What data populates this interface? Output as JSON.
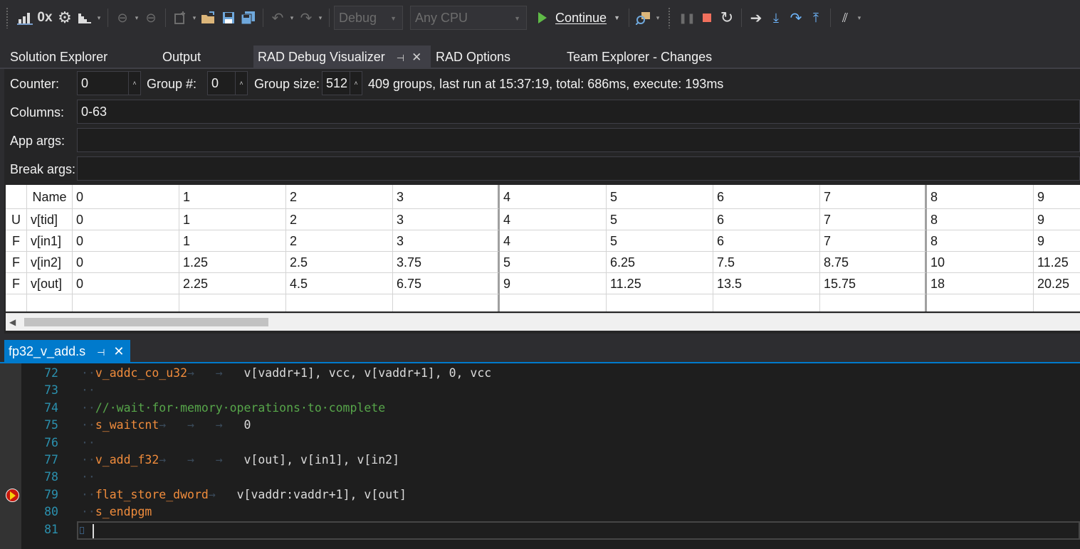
{
  "toolbar": {
    "config_value": "Debug",
    "platform_value": "Any CPU",
    "continue_label": "Continue"
  },
  "tabs": [
    {
      "label": "Solution Explorer"
    },
    {
      "label": "Output"
    },
    {
      "label": "RAD Debug Visualizer"
    },
    {
      "label": "RAD Options"
    },
    {
      "label": "Team Explorer - Changes"
    }
  ],
  "rad": {
    "counter_label": "Counter:",
    "counter_value": "0",
    "group_label": "Group #:",
    "group_value": "0",
    "group_size_label": "Group size:",
    "group_size_value": "512",
    "status": "409 groups, last run at 15:37:19, total: 686ms, execute: 193ms",
    "columns_label": "Columns:",
    "columns_value": "0-63",
    "app_args_label": "App args:",
    "app_args_value": "",
    "break_args_label": "Break args:",
    "break_args_value": ""
  },
  "table": {
    "header": [
      "",
      "Name",
      "0",
      "1",
      "2",
      "3",
      "4",
      "5",
      "6",
      "7",
      "8",
      "9"
    ],
    "rows": [
      [
        "U",
        "v[tid]",
        "0",
        "1",
        "2",
        "3",
        "4",
        "5",
        "6",
        "7",
        "8",
        "9"
      ],
      [
        "F",
        "v[in1]",
        "0",
        "1",
        "2",
        "3",
        "4",
        "5",
        "6",
        "7",
        "8",
        "9"
      ],
      [
        "F",
        "v[in2]",
        "0",
        "1.25",
        "2.5",
        "3.75",
        "5",
        "6.25",
        "7.5",
        "8.75",
        "10",
        "11.25"
      ],
      [
        "F",
        "v[out]",
        "0",
        "2.25",
        "4.5",
        "6.75",
        "9",
        "11.25",
        "13.5",
        "15.75",
        "18",
        "20.25"
      ],
      [
        "",
        "",
        "",
        "",
        "",
        "",
        "",
        "",
        "",
        "",
        "",
        ""
      ]
    ]
  },
  "editor": {
    "tab_label": "fp32_v_add.s",
    "lines": [
      {
        "num": "72",
        "parts": [
          [
            "ws",
            "··"
          ],
          [
            "kw",
            "v_addc_co_u32"
          ],
          [
            "ws",
            "→   →   "
          ],
          [
            "tx",
            "v[vaddr+1], vcc, v[vaddr+1], 0, vcc"
          ]
        ]
      },
      {
        "num": "73",
        "parts": [
          [
            "ws",
            "··"
          ]
        ]
      },
      {
        "num": "74",
        "parts": [
          [
            "ws",
            "··"
          ],
          [
            "cm",
            "//·wait·for·memory·operations·to·complete"
          ]
        ]
      },
      {
        "num": "75",
        "parts": [
          [
            "ws",
            "··"
          ],
          [
            "kw",
            "s_waitcnt"
          ],
          [
            "ws",
            "→   →   →   "
          ],
          [
            "tx",
            "0"
          ]
        ]
      },
      {
        "num": "76",
        "parts": [
          [
            "ws",
            "··"
          ]
        ]
      },
      {
        "num": "77",
        "parts": [
          [
            "ws",
            "··"
          ],
          [
            "kw",
            "v_add_f32"
          ],
          [
            "ws",
            "→   →   →   "
          ],
          [
            "tx",
            "v[out], v[in1], v[in2]"
          ]
        ]
      },
      {
        "num": "78",
        "parts": [
          [
            "ws",
            "··"
          ]
        ]
      },
      {
        "num": "79",
        "parts": [
          [
            "ws",
            "··"
          ],
          [
            "kw",
            "flat_store_dword"
          ],
          [
            "ws",
            "→   "
          ],
          [
            "tx",
            "v[vaddr:vaddr+1], v[out]"
          ]
        ],
        "breakpoint": true
      },
      {
        "num": "80",
        "parts": [
          [
            "ws",
            "··"
          ],
          [
            "kw",
            "s_endpgm"
          ]
        ]
      },
      {
        "num": "81",
        "parts": []
      }
    ]
  }
}
